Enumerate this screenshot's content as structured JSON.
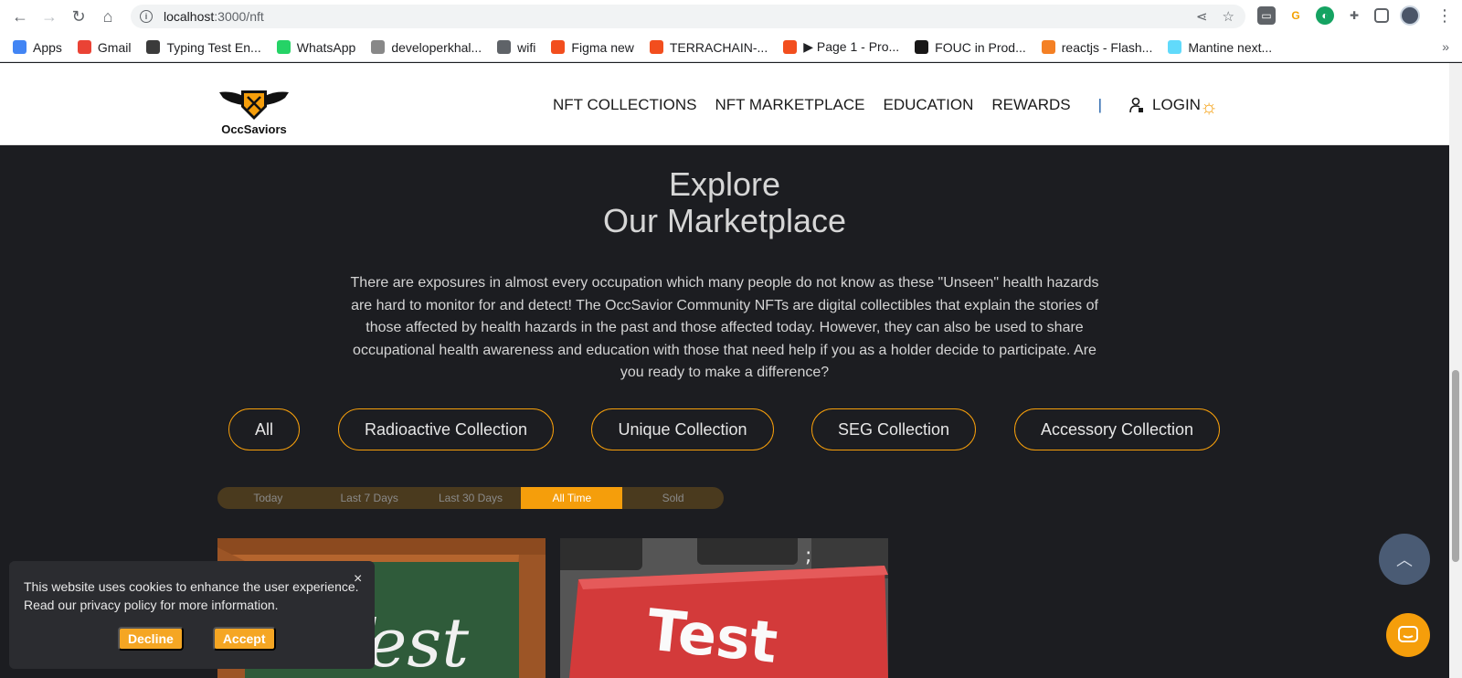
{
  "browser": {
    "url_host": "localhost",
    "url_path": ":3000/nft",
    "bookmarks": [
      {
        "label": "Apps",
        "icon": "apps-grid-icon",
        "color": "#4285f4"
      },
      {
        "label": "Gmail",
        "icon": "gmail-icon",
        "color": "#ea4335"
      },
      {
        "label": "Typing Test En...",
        "icon": "typing-test-icon",
        "color": "#3b3b3b"
      },
      {
        "label": "WhatsApp",
        "icon": "whatsapp-icon",
        "color": "#25d366"
      },
      {
        "label": "developerkhal...",
        "icon": "developer-site-icon",
        "color": "#888888"
      },
      {
        "label": "wifi",
        "icon": "globe-icon",
        "color": "#5f6368"
      },
      {
        "label": "Figma new",
        "icon": "figma-icon",
        "color": "#f24e1e"
      },
      {
        "label": "TERRACHAIN-...",
        "icon": "figma-icon",
        "color": "#f24e1e"
      },
      {
        "label": "▶ Page 1 - Pro...",
        "icon": "figma-icon",
        "color": "#f24e1e"
      },
      {
        "label": "FOUC in Prod...",
        "icon": "github-icon",
        "color": "#181717"
      },
      {
        "label": "reactjs - Flash...",
        "icon": "stackoverflow-icon",
        "color": "#f48024"
      },
      {
        "label": "Mantine next...",
        "icon": "react-icon",
        "color": "#61dafb"
      }
    ],
    "bookmarks_more": "»"
  },
  "header": {
    "logo_text": "OccSaviors",
    "nav": [
      "NFT COLLECTIONS",
      "NFT MARKETPLACE",
      "EDUCATION",
      "REWARDS"
    ],
    "separator": "|",
    "login_label": "LOGIN",
    "accent_color": "#f59e0b"
  },
  "hero": {
    "title_line1": "Explore",
    "title_line2": "Our Marketplace",
    "description": "There are exposures in almost every occupation which many people do not know as these \"Unseen\" health hazards are hard to monitor for and detect! The OccSavior Community NFTs are digital collectibles that explain the stories of those affected by health hazards in the past and those affected today. However, they can also be used to share occupational health awareness and education with those that need help if you as a holder decide to participate. Are you ready to make a difference?"
  },
  "collections": [
    "All",
    "Radioactive Collection",
    "Unique Collection",
    "SEG Collection",
    "Accessory Collection"
  ],
  "time_range": {
    "options": [
      "Today",
      "Last 7 Days",
      "Last 30 Days",
      "All Time",
      "Sold"
    ],
    "selected": "All Time"
  },
  "cards": [
    {
      "text": "Test",
      "image": "chalkboard-image"
    },
    {
      "text": "Test",
      "image": "keyboard-key-image"
    }
  ],
  "cookie_banner": {
    "line1": "This website uses cookies to enhance the user experience.",
    "line2": "Read our privacy policy for more information.",
    "decline_label": "Decline",
    "accept_label": "Accept",
    "close_glyph": "×"
  },
  "scroll_top_glyph": "︿"
}
